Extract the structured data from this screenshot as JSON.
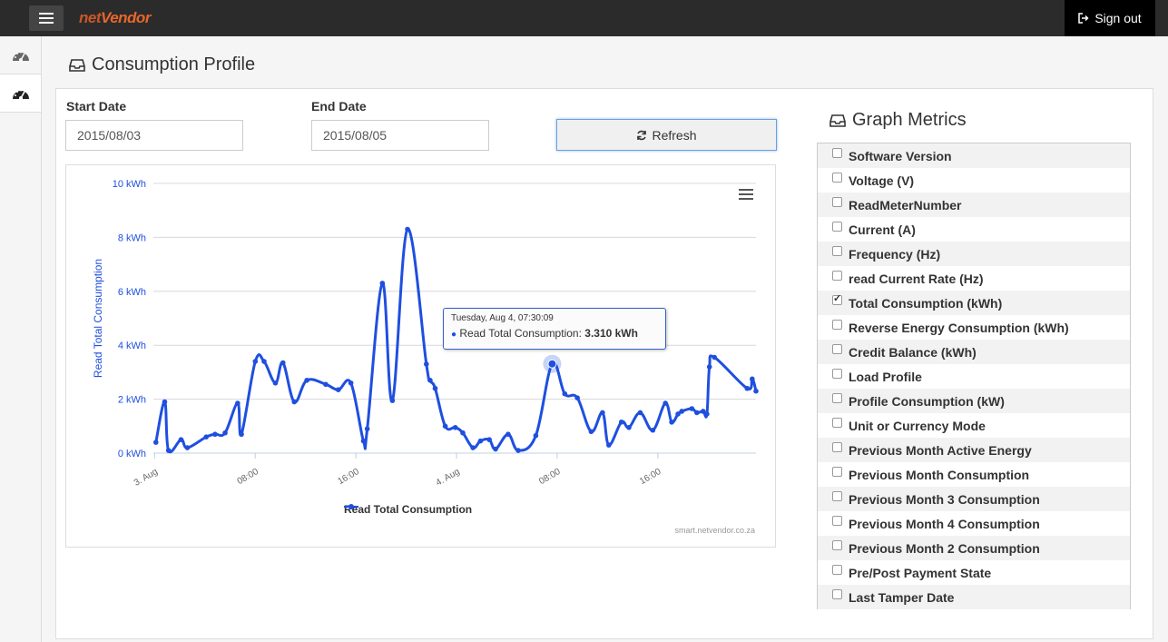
{
  "topbar": {
    "logo_part1": "net",
    "logo_part2": "Vendor",
    "signout_label": "Sign out"
  },
  "page": {
    "title": "Consumption Profile"
  },
  "filters": {
    "start_label": "Start Date",
    "start_value": "2015/08/03",
    "end_label": "End Date",
    "end_value": "2015/08/05",
    "refresh_label": "Refresh"
  },
  "metrics": {
    "title": "Graph Metrics",
    "items": [
      {
        "label": "Software Version",
        "checked": false
      },
      {
        "label": "Voltage (V)",
        "checked": false
      },
      {
        "label": "ReadMeterNumber",
        "checked": false
      },
      {
        "label": "Current (A)",
        "checked": false
      },
      {
        "label": "Frequency (Hz)",
        "checked": false
      },
      {
        "label": "read Current Rate (Hz)",
        "checked": false
      },
      {
        "label": "Total Consumption (kWh)",
        "checked": true
      },
      {
        "label": "Reverse Energy Consumption (kWh)",
        "checked": false
      },
      {
        "label": "Credit Balance (kWh)",
        "checked": false
      },
      {
        "label": "Load Profile",
        "checked": false
      },
      {
        "label": "Profile Consumption (kW)",
        "checked": false
      },
      {
        "label": "Unit or Currency Mode",
        "checked": false
      },
      {
        "label": "Previous Month Active Energy",
        "checked": false
      },
      {
        "label": "Previous Month Consumption",
        "checked": false
      },
      {
        "label": "Previous Month 3 Consumption",
        "checked": false
      },
      {
        "label": "Previous Month 4 Consumption",
        "checked": false
      },
      {
        "label": "Previous Month 2 Consumption",
        "checked": false
      },
      {
        "label": "Pre/Post Payment State",
        "checked": false
      },
      {
        "label": "Last Tamper Date",
        "checked": false
      }
    ]
  },
  "tooltip": {
    "date": "Tuesday, Aug 4, 07:30:09",
    "series": "Read Total Consumption:",
    "value": "3.310 kWh"
  },
  "credits": "smart.netvendor.co.za",
  "chart_data": {
    "type": "line",
    "ylabel": "Read Total Consumption",
    "y_unit": "kWh",
    "ylim": [
      0,
      10
    ],
    "y_ticks": [
      0,
      2,
      4,
      6,
      8,
      10
    ],
    "y_tick_labels": [
      "0 kWh",
      "2 kWh",
      "4 kWh",
      "6 kWh",
      "8 kWh",
      "10 kWh"
    ],
    "xlim_hours": [
      -0.1,
      47.8
    ],
    "x_ticks": [
      0,
      8,
      16,
      24,
      32,
      40
    ],
    "x_tick_labels": [
      "3. Aug",
      "08:00",
      "16:00",
      "4. Aug",
      "08:00",
      "16:00"
    ],
    "grid": true,
    "legend_position": "bottom",
    "color": "#1f4fe0",
    "series": [
      {
        "name": "Read Total Consumption",
        "x_hours": [
          0.1,
          0.8,
          1.1,
          2.1,
          2.6,
          4.1,
          4.8,
          5.6,
          6.6,
          6.9,
          8.0,
          8.7,
          9.6,
          10.2,
          11.1,
          12.1,
          13.6,
          14.6,
          15.6,
          16.6,
          16.9,
          18.1,
          18.9,
          20.1,
          21.6,
          21.9,
          22.3,
          23.1,
          23.9,
          24.5,
          25.3,
          25.9,
          26.6,
          27.1,
          28.1,
          28.9,
          30.3,
          31.6,
          32.6,
          33.6,
          34.7,
          35.6,
          36.1,
          37.1,
          37.7,
          38.6,
          39.6,
          40.6,
          41.1,
          41.6,
          41.9,
          42.7,
          43.1,
          43.6,
          43.9,
          44.1,
          44.5,
          47.1,
          47.5,
          47.8
        ],
        "values": [
          0.4,
          1.9,
          0.1,
          0.5,
          0.2,
          0.6,
          0.7,
          0.75,
          1.85,
          0.7,
          3.4,
          3.4,
          2.6,
          3.35,
          1.9,
          2.7,
          2.55,
          2.35,
          2.6,
          0.45,
          0.9,
          6.3,
          1.95,
          8.3,
          3.3,
          2.7,
          2.4,
          1.0,
          0.95,
          0.75,
          0.2,
          0.45,
          0.5,
          0.15,
          0.7,
          0.1,
          0.65,
          3.31,
          2.2,
          2.05,
          0.8,
          1.5,
          0.3,
          1.15,
          0.95,
          1.5,
          0.85,
          1.85,
          1.15,
          1.45,
          1.55,
          1.65,
          1.5,
          1.55,
          1.45,
          3.2,
          3.55,
          2.4,
          2.75,
          2.3
        ]
      }
    ],
    "highlight_index": 37
  }
}
